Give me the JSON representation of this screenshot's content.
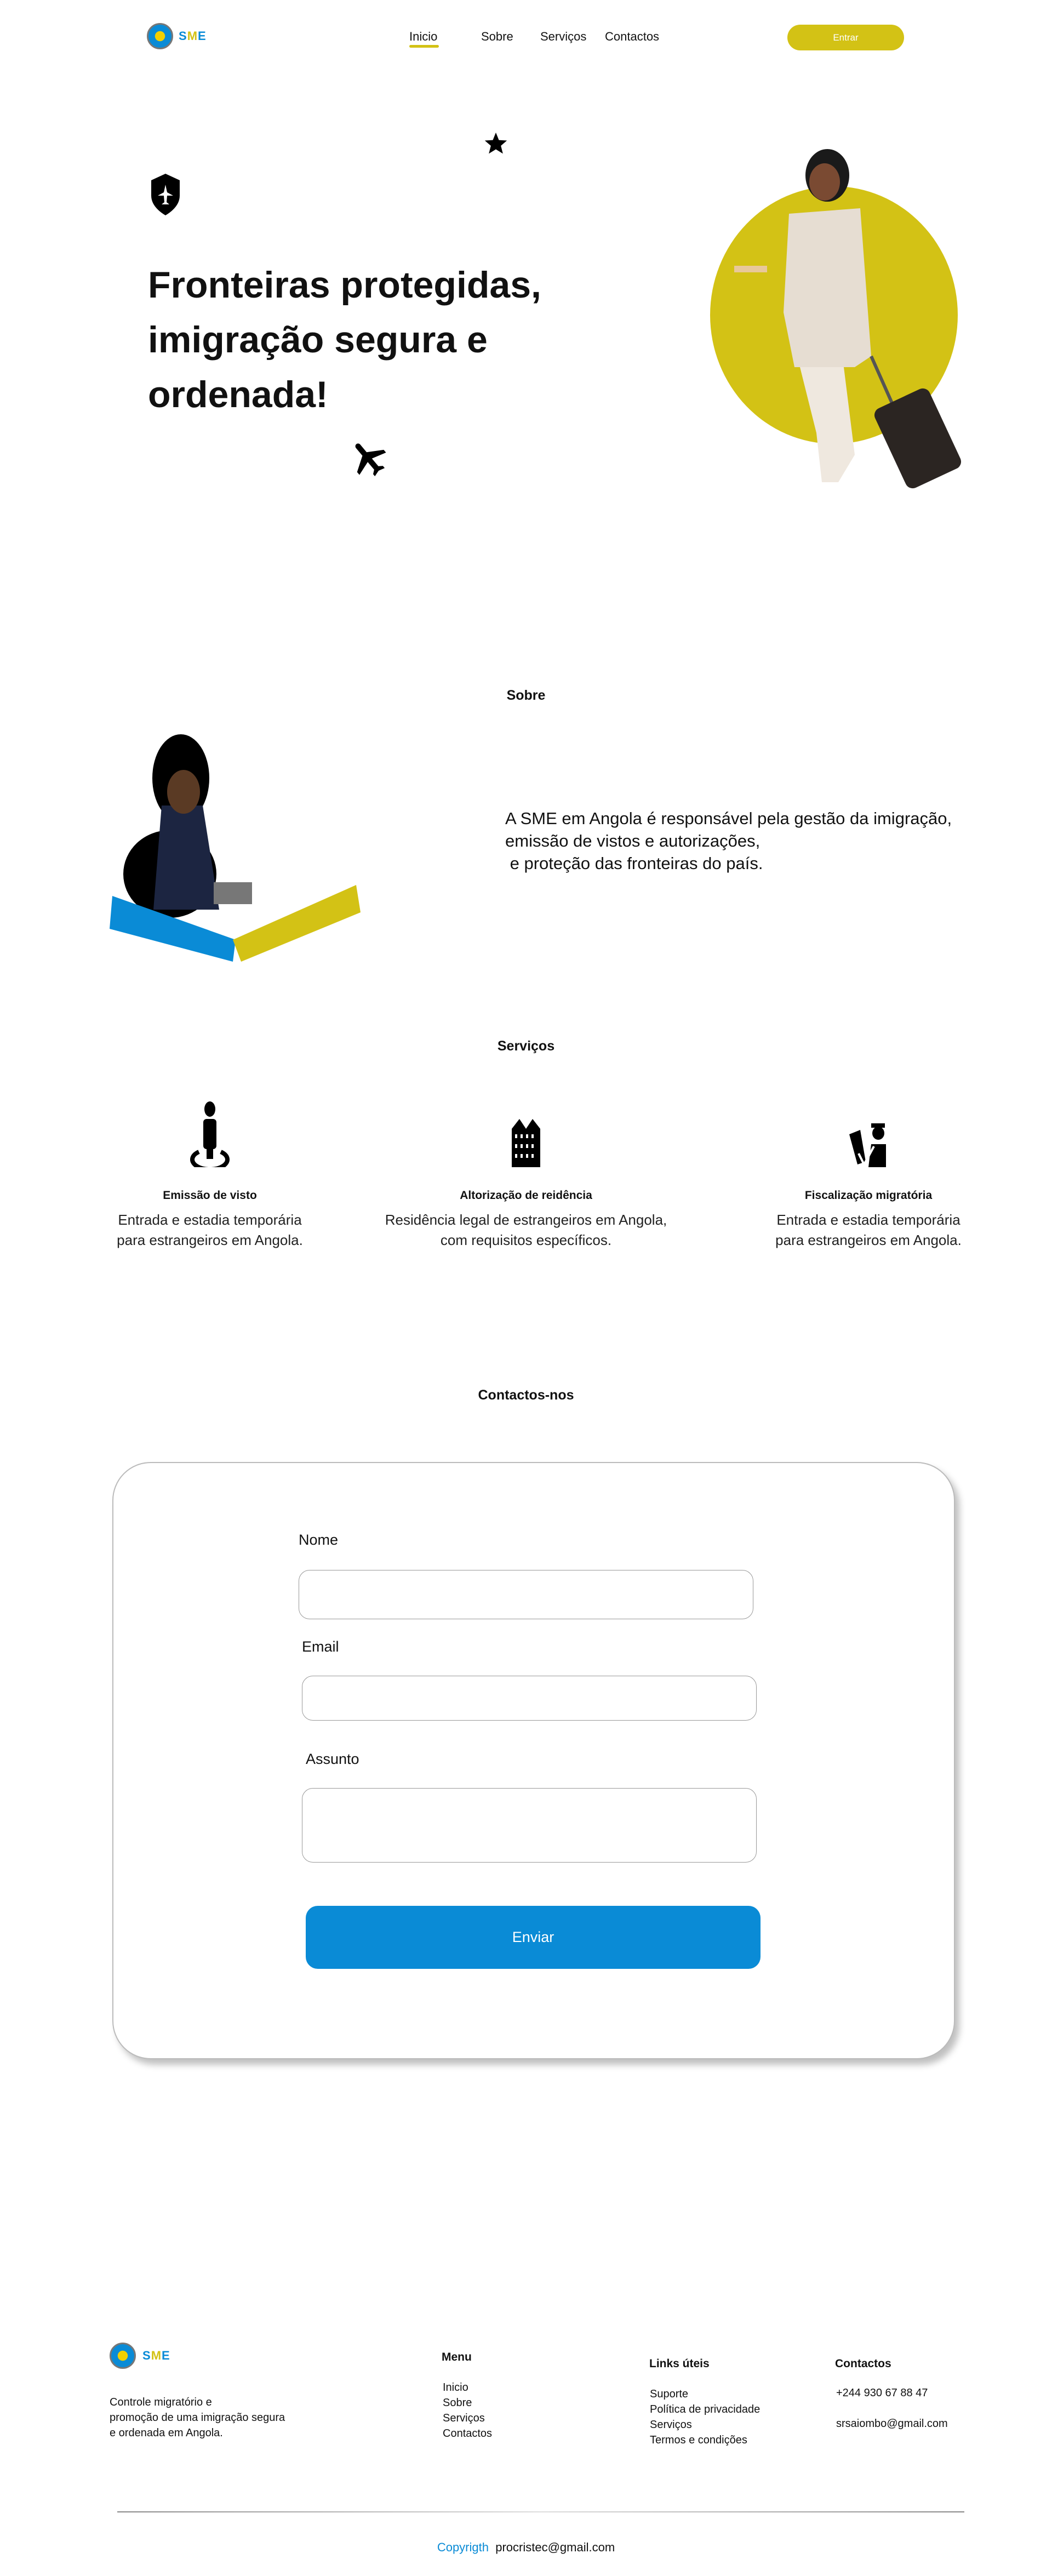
{
  "brand": {
    "name": "SME",
    "colors": {
      "yellow": "#d3c215",
      "blue": "#0a8bd6"
    }
  },
  "nav": {
    "items": [
      {
        "label": "Inicio",
        "active": true
      },
      {
        "label": "Sobre"
      },
      {
        "label": "Serviços"
      },
      {
        "label": "Contactos"
      }
    ],
    "cta": "Entrar"
  },
  "hero": {
    "title": "Fronteiras protegidas, imigração segura e ordenada!",
    "icons": [
      "shield-plane-icon",
      "star-icon",
      "airplane-icon"
    ]
  },
  "about": {
    "heading": "Sobre",
    "lines": [
      "A SME em Angola é responsável pela gestão da imigração,",
      "emissão de vistos e autorizações,",
      " e proteção das fronteiras do país."
    ]
  },
  "services": {
    "heading": "Serviços",
    "items": [
      {
        "icon": "person-location-icon",
        "title": "Emissão de visto",
        "desc": [
          "Entrada e estadia temporária",
          "para estrangeiros em Angola."
        ]
      },
      {
        "icon": "building-icon",
        "title": "Altorização de reidência",
        "desc": [
          "Residência legal de estrangeiros em Angola,",
          "com requisitos específicos."
        ]
      },
      {
        "icon": "officer-icon",
        "title": "Fiscalização migratória",
        "desc": [
          "Entrada e estadia temporária",
          "para estrangeiros em Angola."
        ]
      }
    ]
  },
  "contact": {
    "heading": "Contactos-nos",
    "fields": {
      "name": "Nome",
      "email": "Email",
      "subject": "Assunto"
    },
    "submit": "Enviar"
  },
  "footer": {
    "description": [
      "Controle migratório e",
      "promoção de uma imigração segura",
      "e ordenada em Angola."
    ],
    "menu": {
      "heading": "Menu",
      "items": [
        "Inicio",
        "Sobre",
        "Serviços",
        "Contactos"
      ]
    },
    "links": {
      "heading": "Links úteis",
      "items": [
        "Suporte",
        "Política de privacidade",
        "Serviços",
        "Termos e condições"
      ]
    },
    "contacts": {
      "heading": "Contactos",
      "phone": "+244 930 67 88 47",
      "email": "srsaiombo@gmail.com"
    },
    "copyright_label": "Copyrigth",
    "copyright_email": "procristec@gmail.com"
  }
}
